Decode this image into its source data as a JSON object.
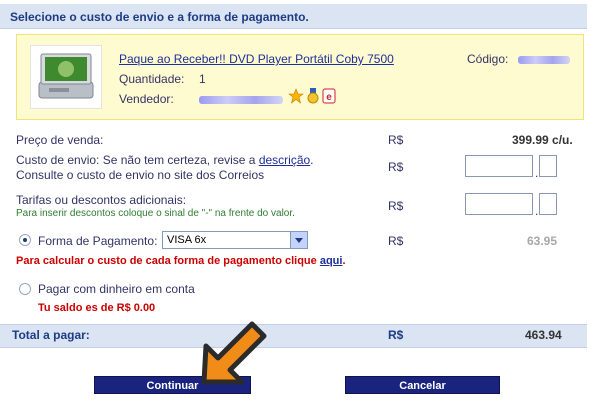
{
  "header": {
    "title": "Selecione o custo de envio e a forma de pagamento."
  },
  "product": {
    "title": "Paque ao Receber!! DVD Player Portátil Coby 7500",
    "codigo_label": "Código:",
    "quantidade_label": "Quantidade:",
    "quantidade_value": "1",
    "vendedor_label": "Vendedor:",
    "image_icon": "dvd-player-image"
  },
  "pricing": {
    "preco_label": "Preço de venda:",
    "preco_currency": "R$",
    "preco_value": "399.99 c/u.",
    "envio_label_prefix": "Custo de envio: Se não tem certeza, revise a",
    "envio_link": "descrição",
    "envio_label_suffix": ".",
    "envio_line2": "Consulte o custo de envio no site dos Correios",
    "envio_currency": "R$",
    "tarifas_label": "Tarifas ou descontos adicionais:",
    "tarifas_hint": "Para inserir descontos coloque o sinal de \"-\" na frente do valor.",
    "tarifas_currency": "R$",
    "forma_label": "Forma de Pagamento:",
    "forma_selected": "VISA 6x",
    "forma_currency": "R$",
    "forma_value": "63.95",
    "calc_note_prefix": "Para calcular o custo de cada forma de pagamento clique",
    "calc_note_link": "aqui",
    "calc_note_suffix": ".",
    "pagar_dinheiro_label": "Pagar com dinheiro em conta",
    "saldo_text": "Tu saldo es de R$ 0.00"
  },
  "total": {
    "label": "Total a pagar:",
    "currency": "R$",
    "value": "463.94"
  },
  "buttons": {
    "continuar": "Continuar",
    "cancelar": "Cancelar"
  },
  "colors": {
    "navy": "#1e3b84",
    "red": "#cc0000",
    "green": "#2e7d32",
    "arrow": "#f28c18",
    "header_bg": "#dbe4f3",
    "product_bg": "#fffbd0"
  }
}
